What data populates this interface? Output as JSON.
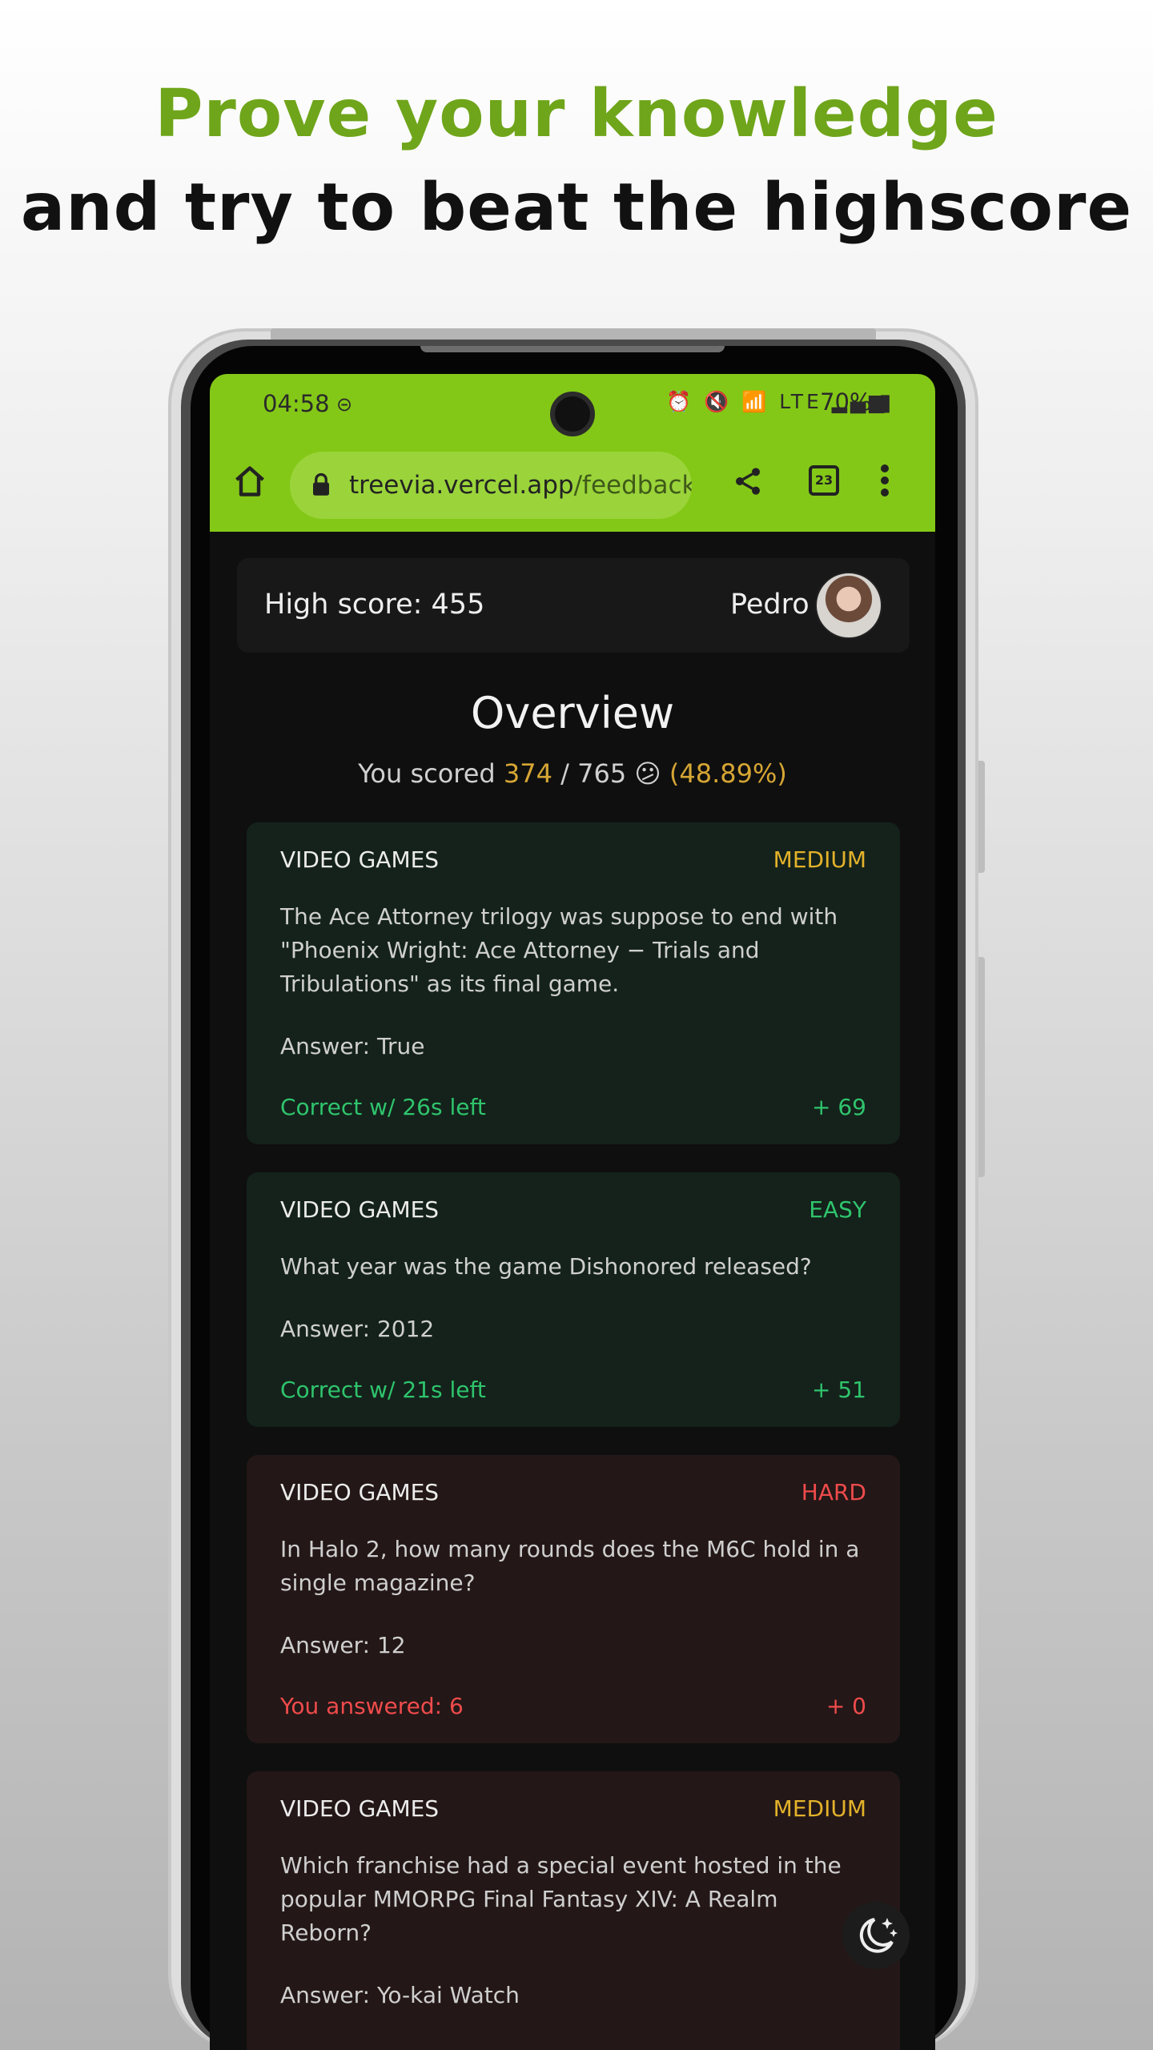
{
  "headline": {
    "line1": "Prove your knowledge",
    "line2": "and try to beat the highscore"
  },
  "status_bar": {
    "time": "04:58",
    "icons": "⏰ 🔇 📶 LTE ▂▄▆",
    "battery": "70%"
  },
  "browser": {
    "url_domain": "treevia.vercel.app",
    "url_path": "/feedback",
    "tab_count": "23",
    "icons": [
      "home-icon",
      "lock-icon",
      "share-icon",
      "tabs-icon",
      "more-vert-icon"
    ]
  },
  "header": {
    "high_score": "High score: 455",
    "username": "Pedro"
  },
  "overview": {
    "title": "Overview",
    "scored_prefix": "You scored",
    "scored_value": "374",
    "scored_total": "/ 765",
    "emoji": "😕",
    "percent": "(48.89%)"
  },
  "questions": [
    {
      "category": "VIDEO GAMES",
      "difficulty": "MEDIUM",
      "question": "The Ace Attorney trilogy was suppose to end with \"Phoenix Wright: Ace Attorney − Trials and Tribulations\" as its final game.",
      "answer": "Answer: True",
      "result": "Correct w/ 26s left",
      "points": "+ 69"
    },
    {
      "category": "VIDEO GAMES",
      "difficulty": "EASY",
      "question": "What year was the game Dishonored released?",
      "answer": "Answer: 2012",
      "result": "Correct w/ 21s left",
      "points": "+ 51"
    },
    {
      "category": "VIDEO GAMES",
      "difficulty": "HARD",
      "question": "In Halo 2, how many rounds does the M6C hold in a single magazine?",
      "answer": "Answer: 12",
      "result": "You answered: 6",
      "points": "+ 0"
    },
    {
      "category": "VIDEO GAMES",
      "difficulty": "MEDIUM",
      "question": "Which franchise had a special event hosted in the popular MMORPG Final Fantasy XIV: A Realm Reborn?",
      "answer": "Answer: Yo-kai Watch"
    }
  ],
  "colors": {
    "accent_green": "#84c817",
    "headline_green": "#6fa51a",
    "correct": "#2fc46c",
    "wrong": "#ef4b4b",
    "medium": "#e3b22a",
    "gold": "#d6a634"
  }
}
